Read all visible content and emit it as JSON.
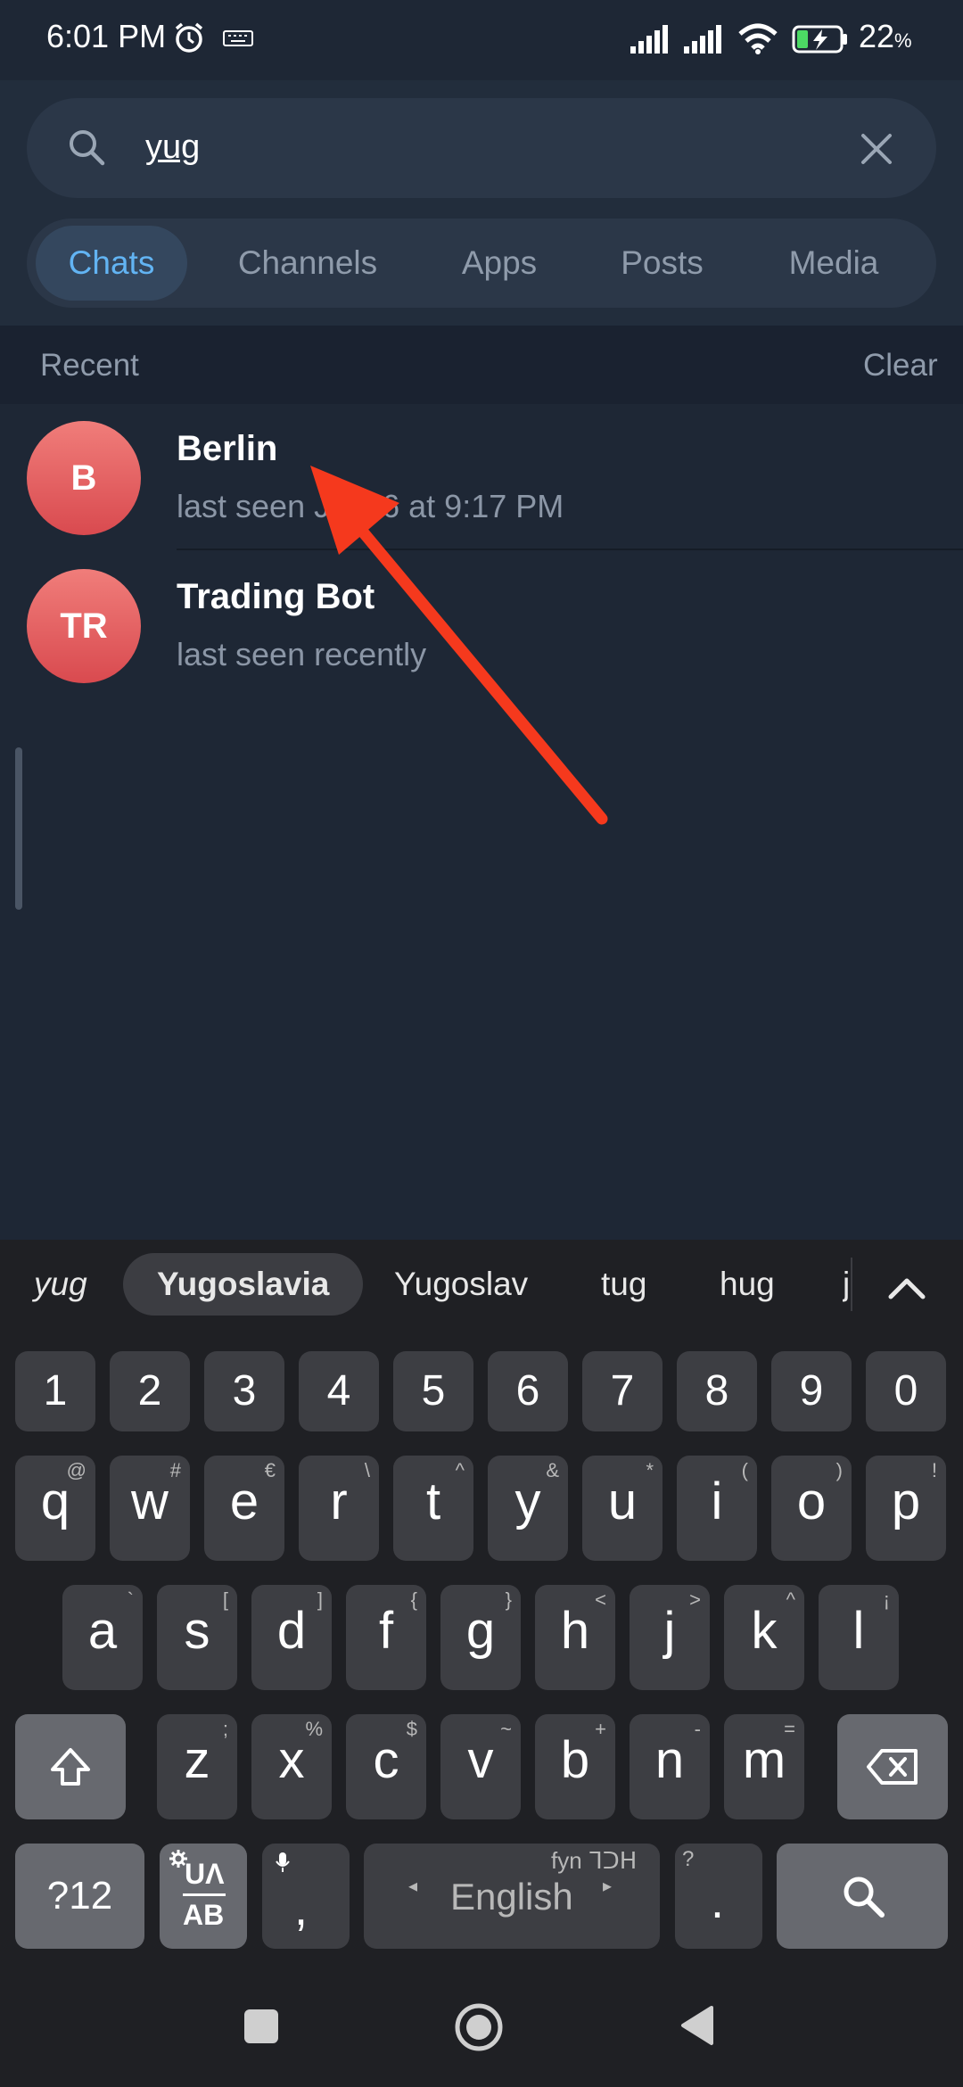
{
  "status_bar": {
    "time": "6:01 PM",
    "battery_number": "22",
    "battery_unit": "%"
  },
  "search": {
    "query": "yug"
  },
  "tabs": [
    {
      "label": "Chats",
      "active": true
    },
    {
      "label": "Channels",
      "active": false
    },
    {
      "label": "Apps",
      "active": false
    },
    {
      "label": "Posts",
      "active": false
    },
    {
      "label": "Media",
      "active": false
    }
  ],
  "recent": {
    "header": "Recent",
    "clear_label": "Clear",
    "items": [
      {
        "initials": "B",
        "name": "Berlin",
        "status": "last seen Jul 06 at 9:17 PM"
      },
      {
        "initials": "TR",
        "name": "Trading Bot",
        "status": "last seen recently"
      }
    ]
  },
  "keyboard": {
    "suggestions": [
      "yug",
      "Yugoslavia",
      "Yugoslav",
      "tug",
      "hug",
      "j"
    ],
    "number_row": [
      "1",
      "2",
      "3",
      "4",
      "5",
      "6",
      "7",
      "8",
      "9",
      "0"
    ],
    "row1": [
      {
        "k": "q",
        "h": "@"
      },
      {
        "k": "w",
        "h": "#"
      },
      {
        "k": "e",
        "h": "€"
      },
      {
        "k": "r",
        "h": "\\"
      },
      {
        "k": "t",
        "h": "^"
      },
      {
        "k": "y",
        "h": "&"
      },
      {
        "k": "u",
        "h": "*"
      },
      {
        "k": "i",
        "h": "("
      },
      {
        "k": "o",
        "h": ")"
      },
      {
        "k": "p",
        "h": "!"
      }
    ],
    "row2": [
      {
        "k": "a",
        "h": "`"
      },
      {
        "k": "s",
        "h": "["
      },
      {
        "k": "d",
        "h": "]"
      },
      {
        "k": "f",
        "h": "{"
      },
      {
        "k": "g",
        "h": "}"
      },
      {
        "k": "h",
        "h": "<"
      },
      {
        "k": "j",
        "h": ">"
      },
      {
        "k": "k",
        "h": "^"
      },
      {
        "k": "l",
        "h": "¡"
      }
    ],
    "row3": [
      {
        "k": "z",
        "h": ";"
      },
      {
        "k": "x",
        "h": "%"
      },
      {
        "k": "c",
        "h": "$"
      },
      {
        "k": "v",
        "h": "~"
      },
      {
        "k": "b",
        "h": "+"
      },
      {
        "k": "n",
        "h": "-"
      },
      {
        "k": "m",
        "h": "="
      }
    ],
    "symbols_label": "?12",
    "lang_switch_top": "UΛ",
    "lang_switch_bottom": "AB",
    "comma": ",",
    "space_label": "English",
    "space_hint": "fyn ᒣᑐᕼ",
    "period": ".",
    "period_hint": "?"
  },
  "colors": {
    "accent": "#62b4f3",
    "avatar": "#e25a5d",
    "arrow": "#f5391d"
  }
}
